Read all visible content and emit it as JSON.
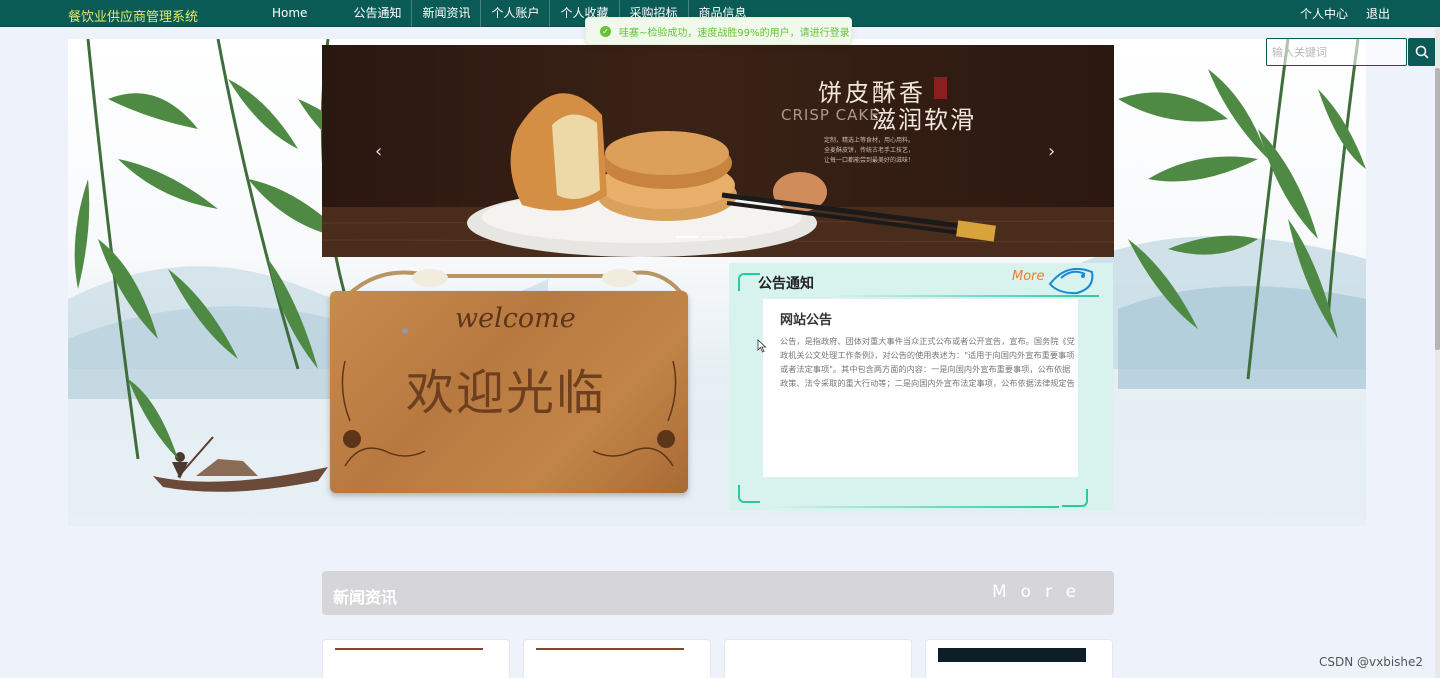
{
  "nav": {
    "brand": "餐饮业供应商管理系统",
    "items": [
      {
        "label": "Home"
      },
      {
        "label": "公告通知"
      },
      {
        "label": "新闻资讯"
      },
      {
        "label": "个人账户"
      },
      {
        "label": "个人收藏"
      },
      {
        "label": "采购招标"
      },
      {
        "label": "商品信息"
      }
    ],
    "user_center": "个人中心",
    "logout": "退出"
  },
  "toast": {
    "message": "哇塞~检验成功，速度战胜99%的用户，请进行登录"
  },
  "search": {
    "placeholder": "输入关键词"
  },
  "banner": {
    "title_cn": "饼皮酥香",
    "title_en": "CRISP CAKE",
    "title_cn2": "滋润软滑",
    "desc_line1": "定制，精选上等食材，用心用料。",
    "desc_line2": "全麦酥皮饼，传统古老手工技艺，",
    "desc_line3": "让每一口都能尝到最美好的滋味！"
  },
  "welcome": {
    "en": "welcome",
    "cn": "欢迎光临"
  },
  "notice": {
    "title": "公告通知",
    "more": "More",
    "card_title": "网站公告",
    "card_text": "公告，是指政府、团体对重大事件当众正式公布或者公开宣告，宣布。国务院《党政机关公文处理工作条例》，对公告的使用表述为：\"适用于向国内外宣布重要事项或者法定事项\"。其中包含两方面的内容：一是向国内外宣布重要事项，公布依据政策、法令采取的重大行动等；二是向国内外宣布法定事项，公布依据法律规定告知国内外的有关重要规定和重大行动等。"
  },
  "news": {
    "title": "新闻资讯",
    "more": "More"
  },
  "watermark": "CSDN @vxbishe2",
  "colors": {
    "nav_bg": "#0a5b56",
    "brand_yellow": "#e2e96b",
    "toast_green": "#67c23a",
    "notice_teal": "#2ec6a6",
    "more_orange": "#f07b2a"
  }
}
